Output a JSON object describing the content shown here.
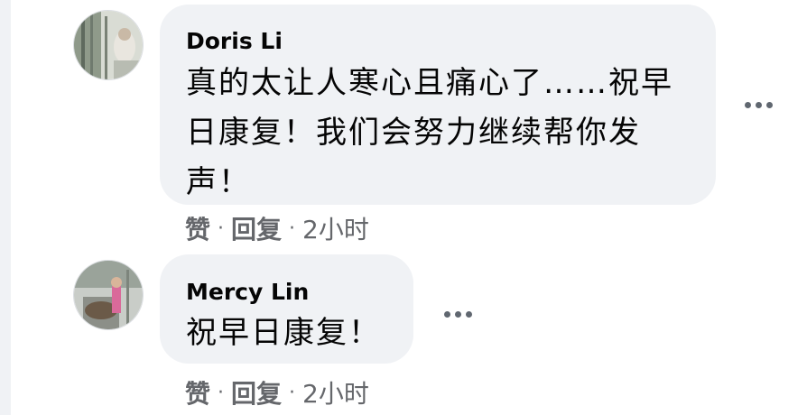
{
  "comments": [
    {
      "author": "Doris Li",
      "lines": [
        "真的太让人寒心且痛心了……祝早",
        "日康复！我们会努力继续帮你发",
        "声！"
      ],
      "actions": {
        "like": "赞",
        "reply": "回复",
        "separator": "·",
        "time": "2小时"
      }
    },
    {
      "author": "Mercy Lin",
      "lines": [
        "祝早日康复！"
      ],
      "actions": {
        "like": "赞",
        "reply": "回复",
        "separator": "·",
        "time": "2小时"
      }
    }
  ],
  "icons": {
    "more": "more-horizontal-icon"
  },
  "colors": {
    "bubble": "#f0f2f5",
    "secondary_text": "#65676b",
    "primary_text": "#050505"
  }
}
